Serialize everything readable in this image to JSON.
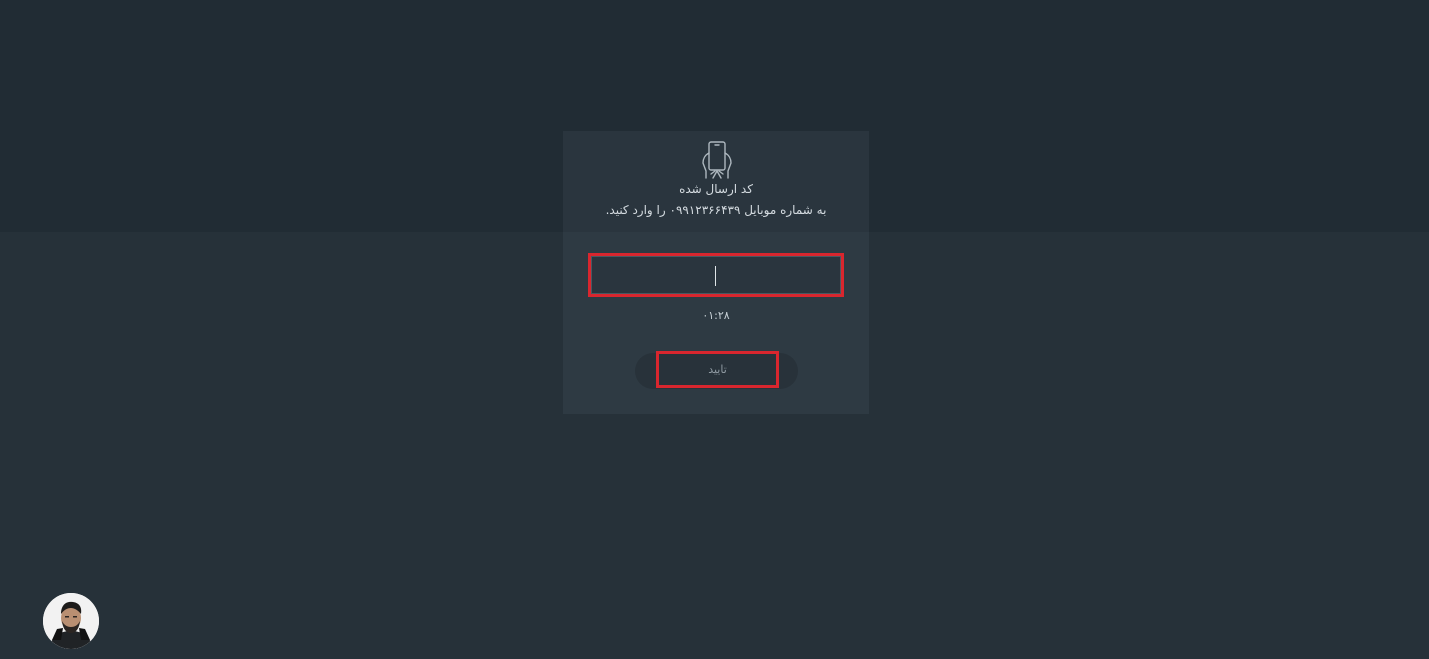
{
  "otp_card": {
    "title": "کد ارسال شده",
    "subtitle": "به شماره موبایل ۰۹۹۱۲۳۶۶۴۳۹ را وارد کنید.",
    "code_value": "",
    "timer": "۰۱:۲۸",
    "confirm_label": "تایید",
    "icon": "phone-in-hand-icon"
  },
  "colors": {
    "background": "#263139",
    "top_band": "#212c34",
    "card": "#2e3a43",
    "highlight": "#d9262e"
  },
  "avatar": {
    "icon": "user-avatar"
  }
}
